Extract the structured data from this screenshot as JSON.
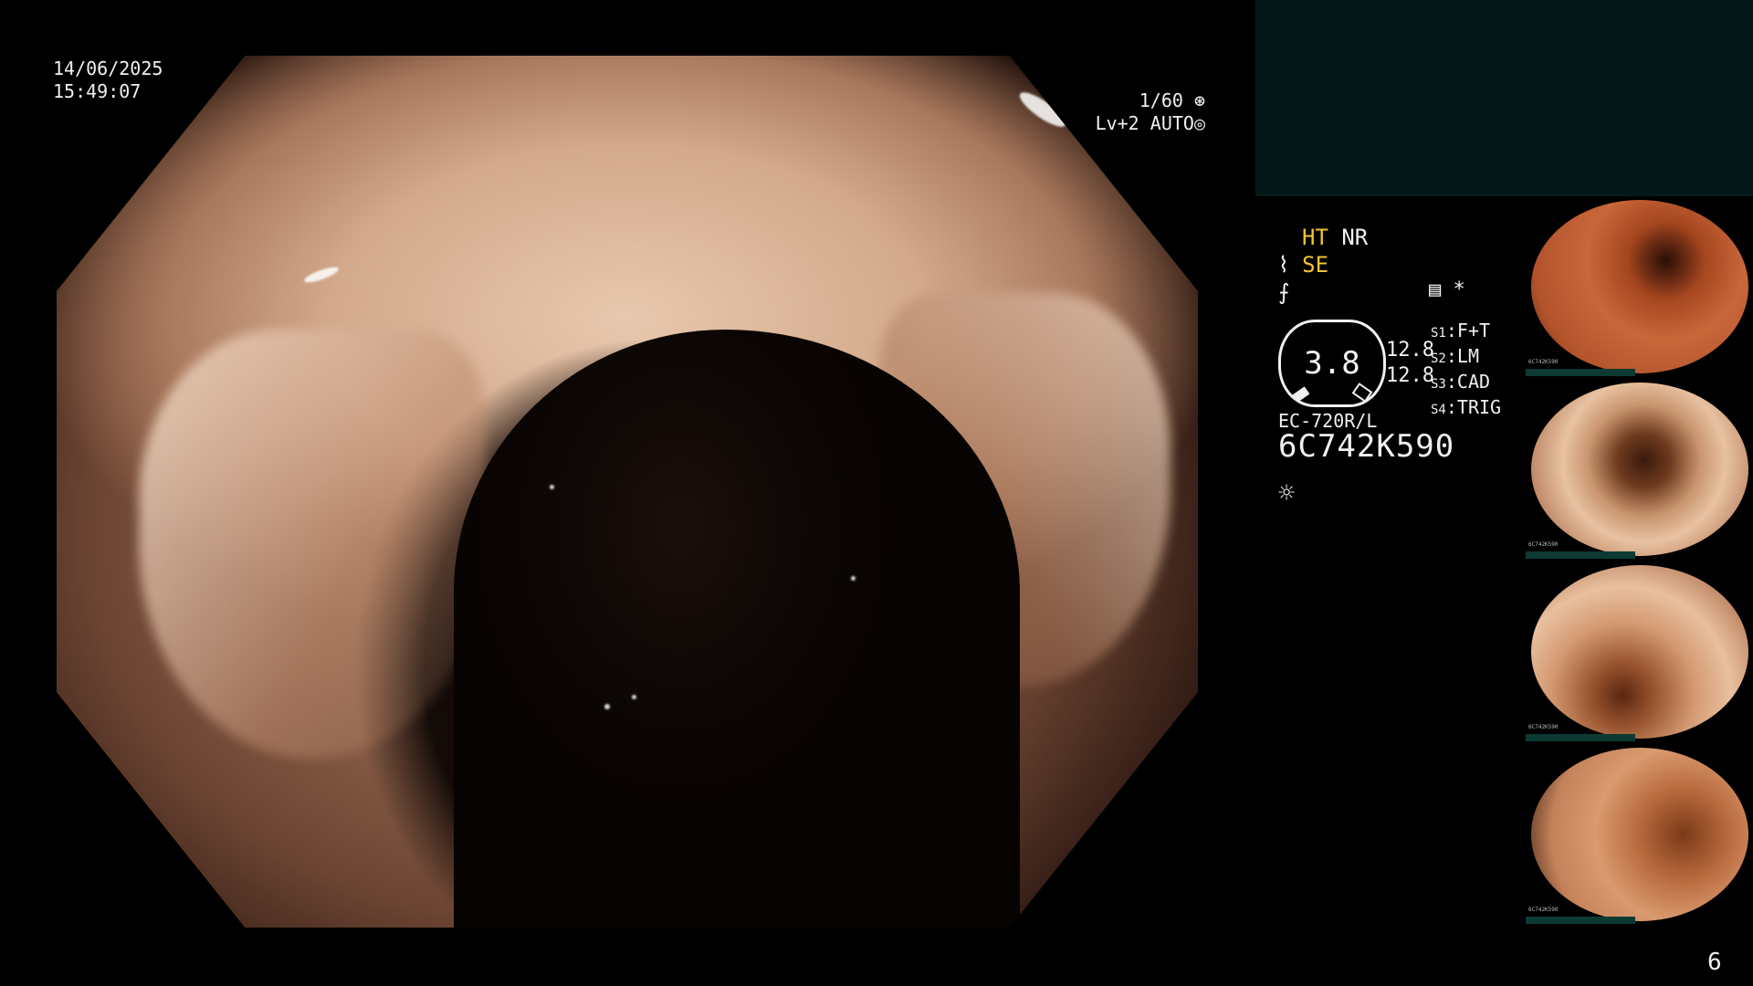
{
  "datetime": {
    "date": "14/06/2025",
    "time": "15:49:07"
  },
  "shutter": {
    "value": "1/60",
    "icon": "shutter-icon"
  },
  "exposure": {
    "level": "Lv+2",
    "mode": "AUTO",
    "icon": "iris-icon"
  },
  "enhancement": {
    "ht": "HT",
    "nr": "NR",
    "se": "SE",
    "se_icon": "structure-enhance-icon",
    "freeze_icon": "freeze-icon"
  },
  "record": {
    "icon": "record-icon",
    "asterisk": "*"
  },
  "gauge": {
    "value": "3.8",
    "left_value": "12.8",
    "right_value": "12.8"
  },
  "switches": [
    {
      "key": "S1",
      "value": "F+T"
    },
    {
      "key": "S2",
      "value": "LM"
    },
    {
      "key": "S3",
      "value": "CAD"
    },
    {
      "key": "S4",
      "value": "TRIG"
    }
  ],
  "scope": {
    "model": "EC-720R/L",
    "serial": "6C742K590",
    "light_icon": "light-icon"
  },
  "thumbnails": [
    {
      "serial": "6C742K590",
      "index": "1"
    },
    {
      "serial": "6C742K590",
      "index": "2"
    },
    {
      "serial": "6C742K590",
      "index": "3"
    },
    {
      "serial": "6C742K590",
      "index": "4"
    }
  ],
  "page_number": "6",
  "colors": {
    "overlay_text": "#f0f0f0",
    "accent_yellow": "#f2c233",
    "panel_teal": "#041917"
  }
}
